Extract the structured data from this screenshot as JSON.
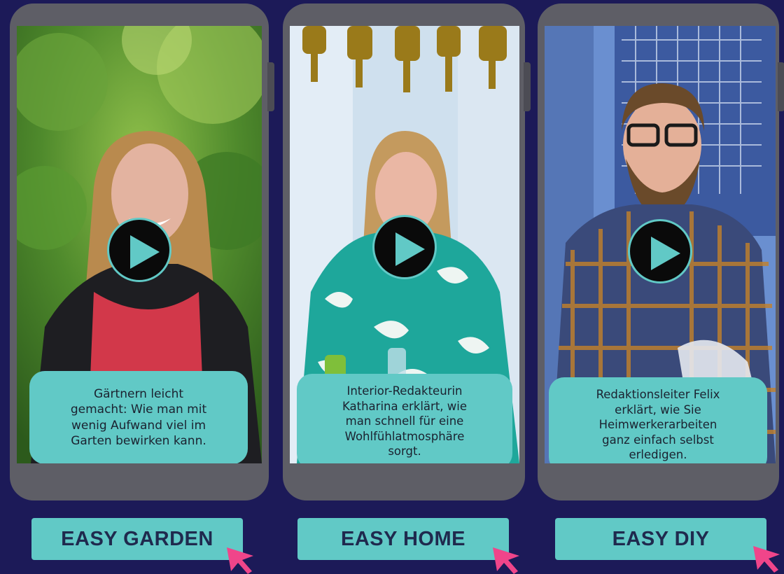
{
  "cards": [
    {
      "caption": "Gärtnern leicht\ngemacht: Wie man mit\nwenig Aufwand viel im\nGarten bewirken kann.",
      "label": "EASY GARDEN"
    },
    {
      "caption": "Interior-Redakteurin\nKatharina erklärt, wie\nman schnell für eine\nWohlfühlatmosphäre\nsorgt.",
      "label": "EASY HOME"
    },
    {
      "caption": "Redaktionsleiter Felix\nerklärt, wie Sie\nHeimwerkerarbeiten\nganz einfach selbst\nerledigen.",
      "label": "EASY DIY"
    }
  ],
  "colors": {
    "background": "#1c1a58",
    "accent": "#61c9c6",
    "phone": "#5e5e66",
    "cursor": "#f0458a"
  },
  "icons": {
    "play": "play-icon",
    "cursor": "cursor-arrow-icon"
  }
}
